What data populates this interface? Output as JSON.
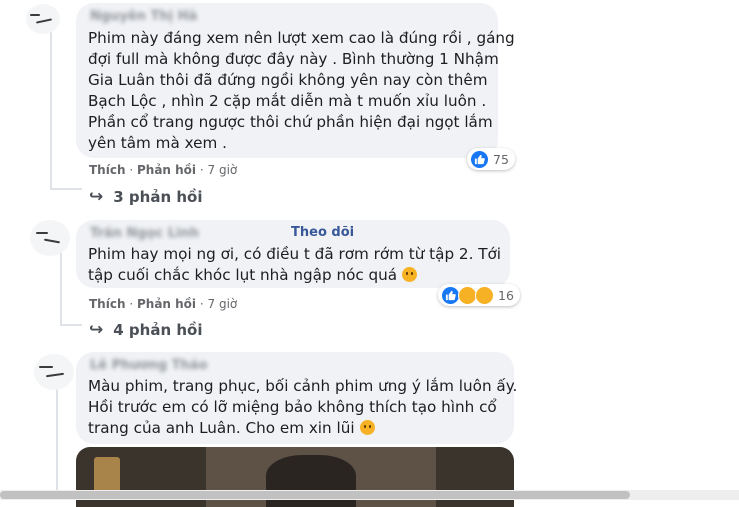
{
  "comments": [
    {
      "lines": [
        "Phim này đáng xem nên lượt xem cao là đúng rồi , gáng",
        "đợi full mà không được đây này . Bình thường 1 Nhậm",
        "Gia Luân thôi đã đứng ngồi không yên nay còn thêm",
        "Bạch Lộc , nhìn 2 cặp mắt diễn mà t muốn xỉu luôn .",
        "Phần cổ trang ngược thôi chứ phần hiện đại ngọt lắm",
        "yên tâm mà xem ."
      ],
      "like_label": "Thích",
      "reply_label": "Phản hồi",
      "time": "7 giờ",
      "reaction_count": "75",
      "replies_label": "3 phản hồi"
    },
    {
      "follow_label": "Theo dõi",
      "lines": [
        "Phim hay mọi ng ơi, có điều t đã rơm rớm từ tập 2. Tới",
        "tập cuối chắc khóc lụt nhà ngập nóc quá"
      ],
      "like_label": "Thích",
      "reply_label": "Phản hồi",
      "time": "7 giờ",
      "reaction_count": "16",
      "replies_label": "4 phản hồi"
    },
    {
      "lines": [
        "Màu phim, trang phục, bối cảnh phim ưng ý lắm luôn ấy.",
        "Hồi trước em có lỡ miệng bảo không thích tạo hình cổ",
        "trang của anh Luân. Cho em xin lũi"
      ]
    }
  ],
  "separator": "·",
  "reply_arrow": "↪",
  "colors": {
    "bubble": "#f0f2f5",
    "like_blue": "#1877f2",
    "emoji_yellow": "#f7b125",
    "follow_link": "#385898"
  }
}
